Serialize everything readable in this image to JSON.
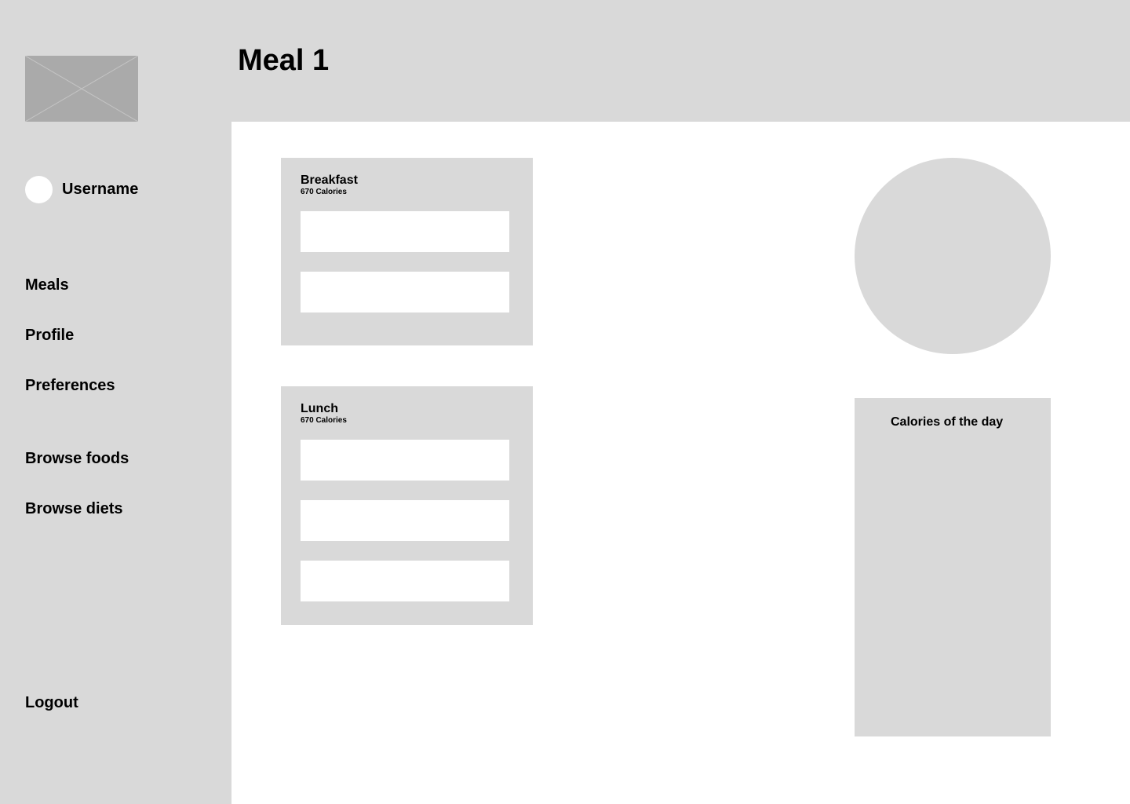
{
  "header": {
    "title": "Meal 1"
  },
  "sidebar": {
    "logo_icon": "image-placeholder-icon",
    "user": {
      "name": "Username",
      "avatar_icon": "avatar-icon"
    },
    "nav": {
      "meals": "Meals",
      "profile": "Profile",
      "preferences": "Preferences",
      "browse_foods": "Browse foods",
      "browse_diets": "Browse diets"
    },
    "logout": "Logout"
  },
  "meals": [
    {
      "name": "Breakfast",
      "calories": "670 Calories",
      "food_slots": 2
    },
    {
      "name": "Lunch",
      "calories": "670 Calories",
      "food_slots": 3
    }
  ],
  "calories_panel": {
    "title": "Calories of the day"
  },
  "colors": {
    "panel_bg": "#d9d9d9",
    "placeholder": "#aaaaaa",
    "background": "#ffffff",
    "text": "#000000"
  }
}
